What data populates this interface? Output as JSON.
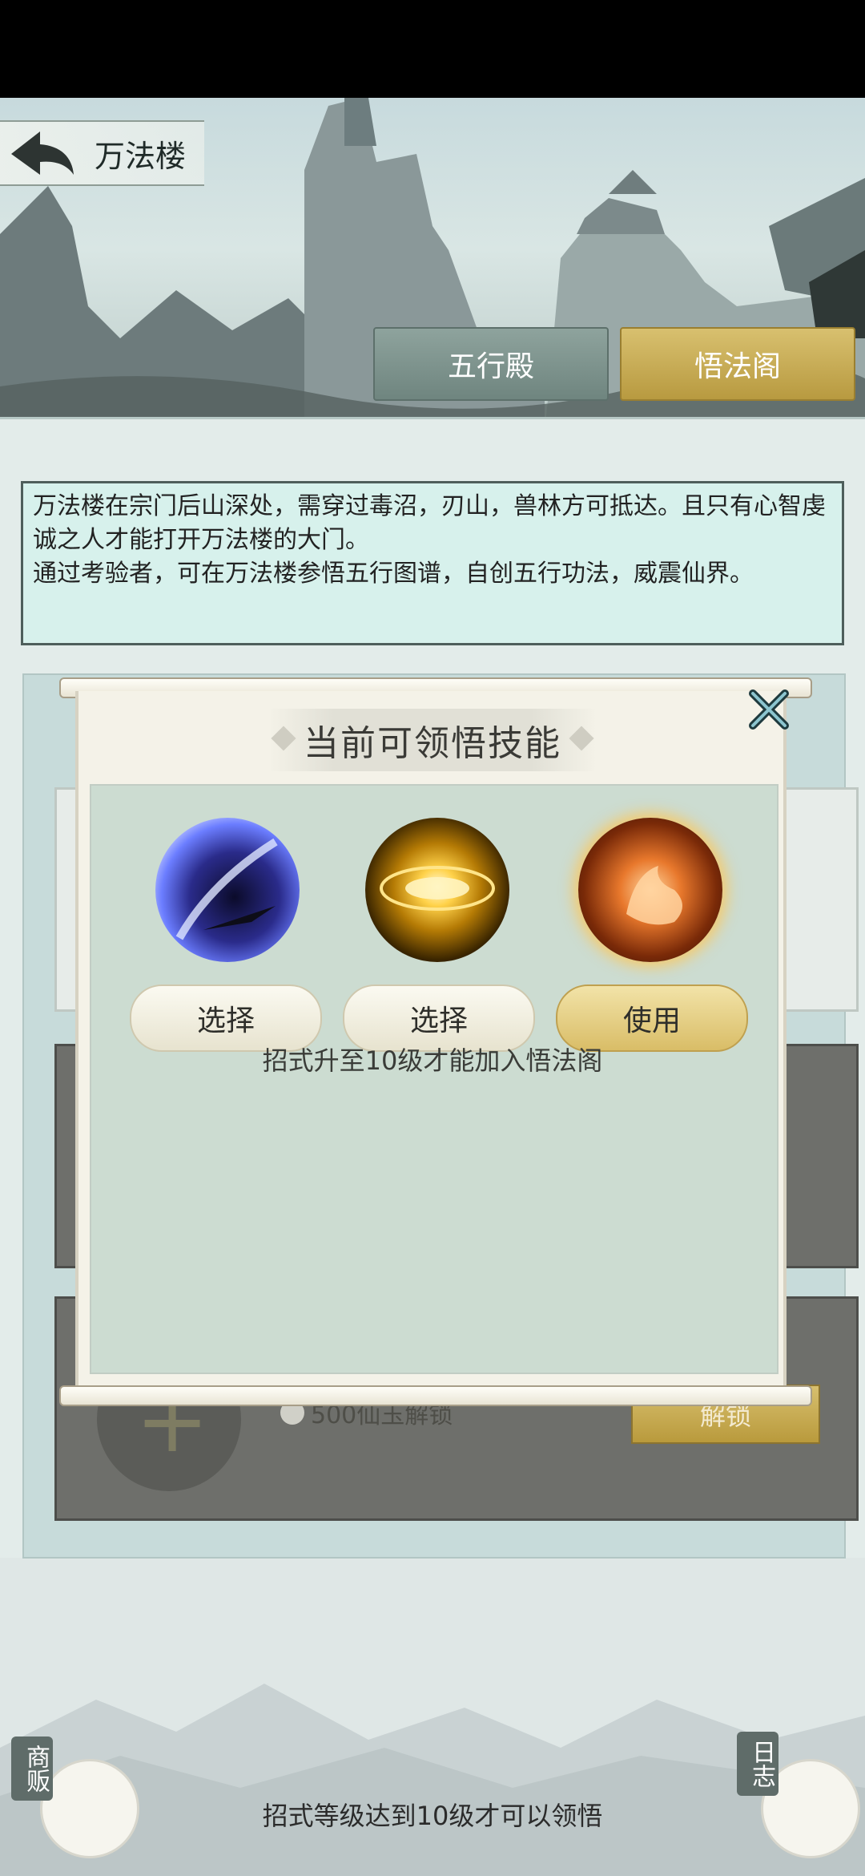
{
  "header": {
    "title": "万法楼",
    "tabs": [
      {
        "label": "五行殿",
        "active": false
      },
      {
        "label": "悟法阁",
        "active": true
      }
    ]
  },
  "description": {
    "line1": "万法楼在宗门后山深处，需穿过毒沼，刃山，兽林方可抵达。且只有心智虔诚之人才能打开万法楼的大门。",
    "line2": "通过考验者，可在万法楼参悟五行图谱，自创五行功法，威震仙界。"
  },
  "background_slot": {
    "unlock_text": "500仙玉解锁",
    "unlock_button": "解锁"
  },
  "modal": {
    "title": "当前可领悟技能",
    "skills": [
      {
        "icon": "blade-slash-skill-icon",
        "button": "选择"
      },
      {
        "icon": "golden-sigil-skill-icon",
        "button": "选择"
      },
      {
        "icon": "fire-fox-skill-icon",
        "button": "使用"
      }
    ],
    "hint": "招式升至10级才能加入悟法阁"
  },
  "footer": {
    "hint": "招式等级达到10级才可以领悟",
    "left_button": "商贩",
    "right_button": "日志"
  },
  "colors": {
    "tab_active": "#c9ad55",
    "tab_inactive": "#7f948e",
    "description_bg": "#d7f1ec",
    "modal_bg": "#ccdcd1"
  }
}
